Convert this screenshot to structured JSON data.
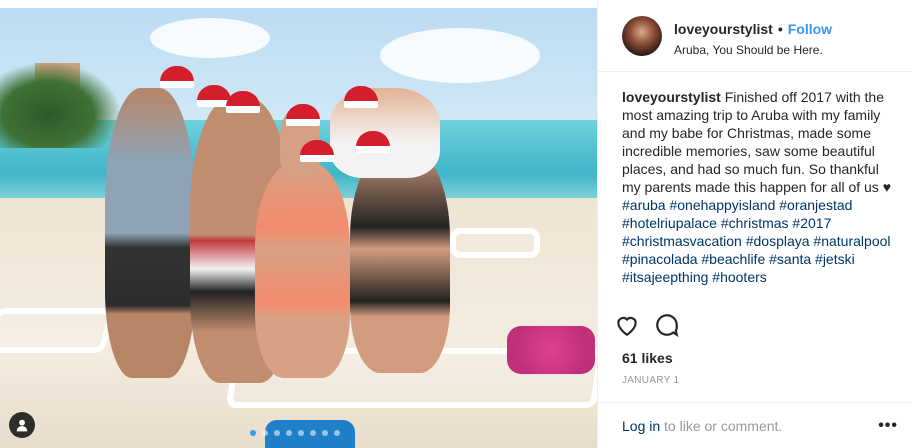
{
  "post": {
    "username": "loveyourstylist",
    "follow_label": "Follow",
    "separator": "•",
    "location": "Aruba, You Should be Here.",
    "caption_user": "loveyourstylist",
    "caption_text": " Finished off 2017 with the most amazing trip to Aruba with my family and my babe for Christmas, made some incredible memories, saw some beautiful places, and had so much fun. So thankful my parents made this happen for all of us ",
    "caption_emoji": "♥",
    "hashtags": "#aruba #onehappyisland #oranjestad #hotelriupalace #christmas #2017 #christmasvacation #dosplaya #naturalpool #pinacolada #beachlife #santa #jetski #itsajeepthing #hooters",
    "likes": "61 likes",
    "date": "JANUARY 1",
    "login_link": "Log in",
    "login_rest": " to like or comment.",
    "more_label": "•••",
    "media_carousel": {
      "count": 8,
      "active": 1
    },
    "icons": {
      "like": "heart-icon",
      "comment": "comment-icon",
      "tag": "user-tag-icon",
      "more": "more-options-icon"
    },
    "colors": {
      "accent": "#3897f0",
      "hashtag": "#003569",
      "muted": "#999999"
    }
  }
}
